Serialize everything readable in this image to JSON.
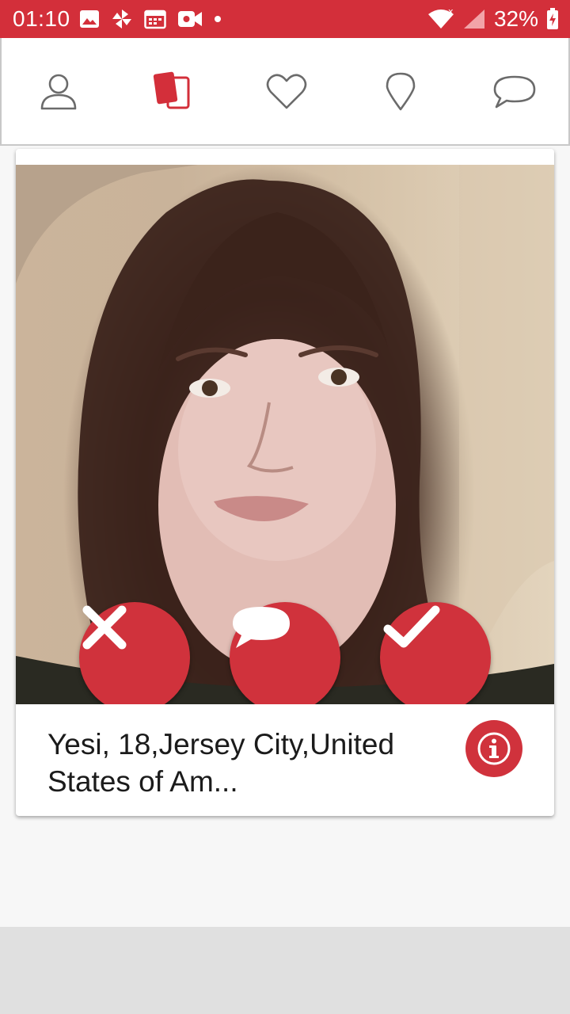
{
  "status_bar": {
    "time": "01:10",
    "battery": "32%",
    "left_icons": [
      "image-icon",
      "pinwheel-icon",
      "calendar-icon",
      "video-icon",
      "dot-icon"
    ],
    "right_icons": [
      "wifi-icon",
      "signal-icon",
      "battery-charging-icon"
    ]
  },
  "nav": {
    "items": [
      {
        "icon": "profile-icon",
        "active": false
      },
      {
        "icon": "cards-icon",
        "active": true
      },
      {
        "icon": "heart-icon",
        "active": false
      },
      {
        "icon": "location-pin-icon",
        "active": false
      },
      {
        "icon": "chat-bubble-icon",
        "active": false
      }
    ]
  },
  "profile": {
    "summary": "Yesi, 18,Jersey City,United States of Am..."
  },
  "actions": [
    "dislike-x-icon",
    "message-bubble-icon",
    "like-check-icon"
  ],
  "colors": {
    "accent": "#d32f3a",
    "inactive_icon": "#6b6b6b"
  }
}
